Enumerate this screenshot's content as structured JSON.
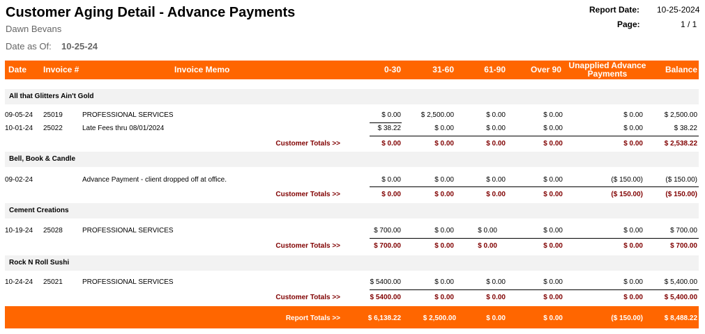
{
  "report": {
    "title": "Customer Aging Detail - Advance Payments",
    "subtitle": "Dawn Bevans",
    "date_as_of_label": "Date as Of:",
    "date_as_of_value": "10-25-24",
    "report_date_label": "Report Date:",
    "report_date_value": "10-25-2024",
    "page_label": "Page:",
    "page_value": "1 / 1"
  },
  "colors": {
    "header_bg": "#ff6600",
    "group_bg": "#f2f2f2",
    "totals_text": "#800000"
  },
  "columns": {
    "date": "Date",
    "invoice": "Invoice #",
    "memo": "Invoice Memo",
    "c0_30": "0-30",
    "c31_60": "31-60",
    "c61_90": "61-90",
    "over90": "Over  90",
    "unapplied_line1": "Unapplied Advance",
    "unapplied_line2": "Payments",
    "balance": "Balance"
  },
  "groups": [
    {
      "name": "All that Glitters Ain't Gold",
      "rows": [
        {
          "date": "09-05-24",
          "invoice": "25019",
          "memo": "PROFESSIONAL SERVICES",
          "c0_30": "$ 0.00",
          "c31_60": "$ 2,500.00",
          "c61_90": "$ 0.00",
          "over90": "$ 0.00",
          "unapplied": "$ 0.00",
          "balance": "$ 2,500.00"
        },
        {
          "date": "10-01-24",
          "invoice": "25022",
          "memo": "Late Fees thru 08/01/2024",
          "c0_30": "$ 38.22",
          "c31_60": "$ 0.00",
          "c61_90": "$ 0.00",
          "over90": "$ 0.00",
          "unapplied": "$ 0.00",
          "balance": "$ 38.22"
        }
      ],
      "totals": {
        "label": "Customer Totals >>",
        "c0_30": "$ 0.00",
        "c31_60": "$ 0.00",
        "c61_90": "$ 0.00",
        "over90": "$ 0.00",
        "unapplied": "$ 0.00",
        "balance": "$ 2,538.22"
      }
    },
    {
      "name": "Bell, Book & Candle",
      "rows": [
        {
          "date": "09-02-24",
          "invoice": "",
          "memo": "Advance Payment - client dropped off at office.",
          "c0_30": "$ 0.00",
          "c31_60": "$ 0.00",
          "c61_90": "$ 0.00",
          "over90": "$ 0.00",
          "unapplied": "($ 150.00)",
          "balance": "($ 150.00)"
        }
      ],
      "totals": {
        "label": "Customer Totals >>",
        "c0_30": "$ 0.00",
        "c31_60": "$ 0.00",
        "c61_90": "$ 0.00",
        "over90": "$ 0.00",
        "unapplied": "($ 150.00)",
        "balance": "($ 150.00)"
      }
    },
    {
      "name": "Cement Creations",
      "rows": [
        {
          "date": "10-19-24",
          "invoice": "25028",
          "memo": "PROFESSIONAL SERVICES",
          "c0_30": "$ 700.00",
          "c31_60": "$ 0.00",
          "c61_90": "$ 0.00",
          "over90": "$ 0.00",
          "unapplied": "$ 0.00",
          "balance": "$ 700.00"
        }
      ],
      "totals": {
        "label": "Customer Totals >>",
        "c0_30": "$ 700.00",
        "c31_60": "$ 0.00",
        "c61_90": "$ 0.00",
        "over90": "$ 0.00",
        "unapplied": "$ 0.00",
        "balance": "$ 700.00"
      }
    },
    {
      "name": "Rock N Roll Sushi",
      "rows": [
        {
          "date": "10-24-24",
          "invoice": "25021",
          "memo": "PROFESSIONAL SERVICES",
          "c0_30": "$ 5400.00",
          "c31_60": "$ 0.00",
          "c61_90": "$ 0.00",
          "over90": "$ 0.00",
          "unapplied": "$ 0.00",
          "balance": "$ 5,400.00"
        }
      ],
      "totals": {
        "label": "Customer Totals >>",
        "c0_30": "$ 5400.00",
        "c31_60": "$ 0.00",
        "c61_90": "$ 0.00",
        "over90": "$ 0.00",
        "unapplied": "$ 0.00",
        "balance": "$ 5,400.00"
      }
    }
  ],
  "report_totals": {
    "label": "Report Totals >>",
    "c0_30": "$ 6,138.22",
    "c31_60": "$ 2,500.00",
    "c61_90": "$ 0.00",
    "over90": "$ 0.00",
    "unapplied": "($ 150.00)",
    "balance": "$ 8,488.22"
  }
}
